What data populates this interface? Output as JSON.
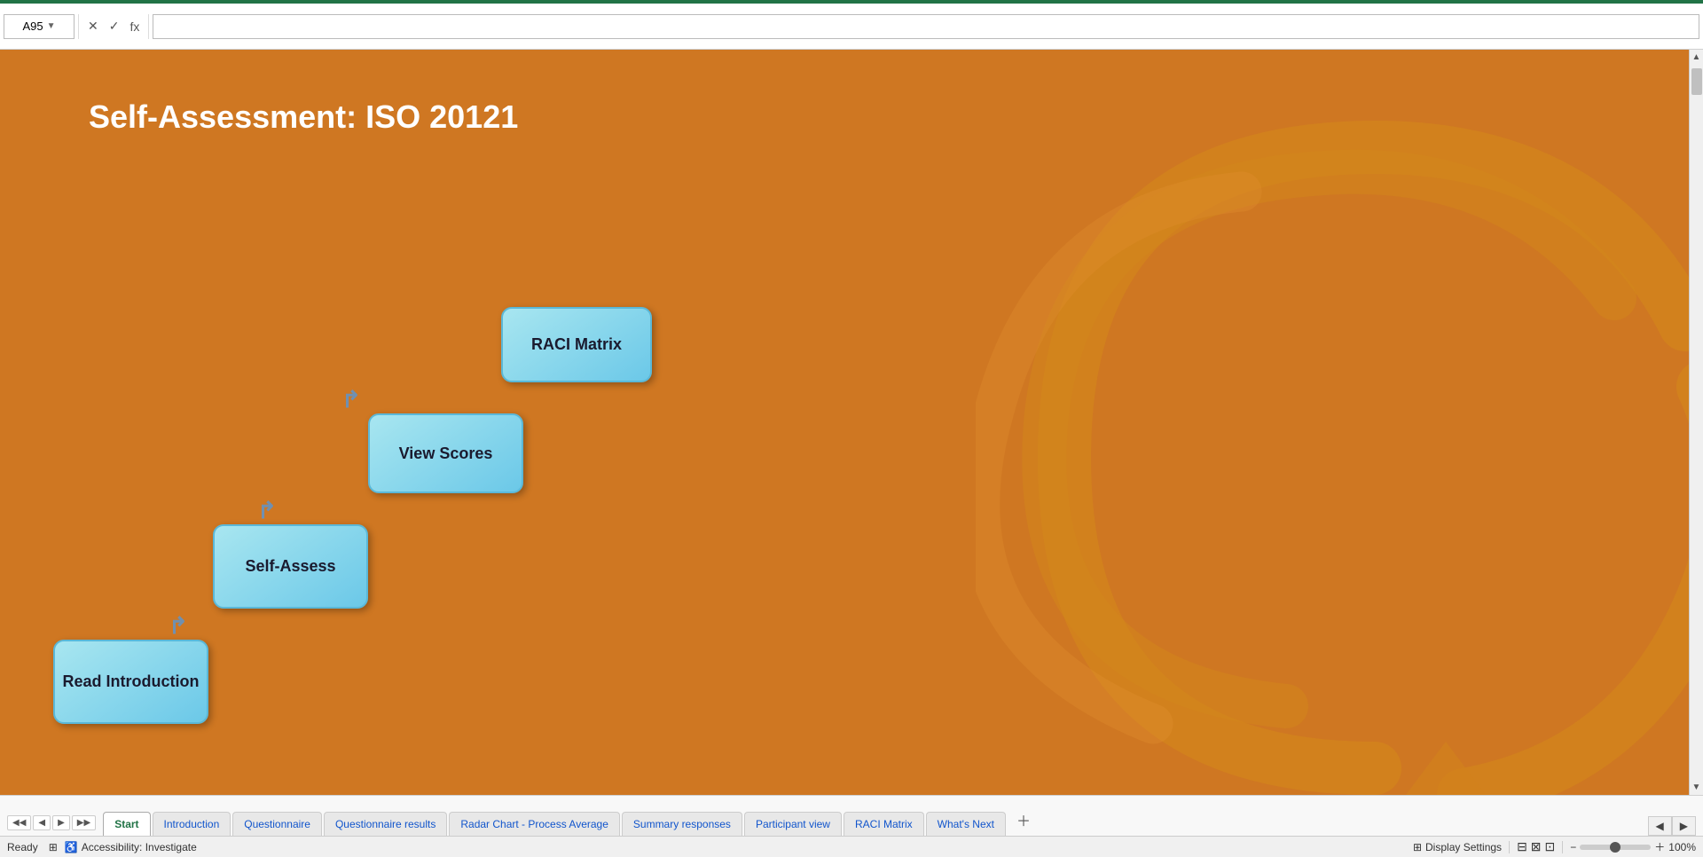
{
  "topbar": {
    "cell_ref": "A95",
    "formula_x": "✕",
    "formula_check": "✓",
    "formula_fx": "fx",
    "formula_value": ""
  },
  "main": {
    "title": "Self-Assessment: ISO 20121",
    "background_color": "#CF7722"
  },
  "steps": [
    {
      "id": "read",
      "label": "Read\nIntroduction"
    },
    {
      "id": "assess",
      "label": "Self-Assess"
    },
    {
      "id": "scores",
      "label": "View Scores"
    },
    {
      "id": "raci",
      "label": "RACI Matrix"
    }
  ],
  "tabs": [
    {
      "id": "start",
      "label": "Start",
      "active": true
    },
    {
      "id": "introduction",
      "label": "Introduction"
    },
    {
      "id": "questionnaire",
      "label": "Questionnaire"
    },
    {
      "id": "questionnaire-results",
      "label": "Questionnaire results"
    },
    {
      "id": "radar-chart",
      "label": "Radar Chart - Process Average"
    },
    {
      "id": "summary-responses",
      "label": "Summary responses"
    },
    {
      "id": "participant-view",
      "label": "Participant view"
    },
    {
      "id": "raci-matrix",
      "label": "RACI Matrix"
    },
    {
      "id": "whats-next",
      "label": "What's Next"
    }
  ],
  "statusbar": {
    "ready": "Ready",
    "accessibility": "Accessibility: Investigate",
    "display_settings": "Display Settings",
    "zoom": "100%"
  }
}
